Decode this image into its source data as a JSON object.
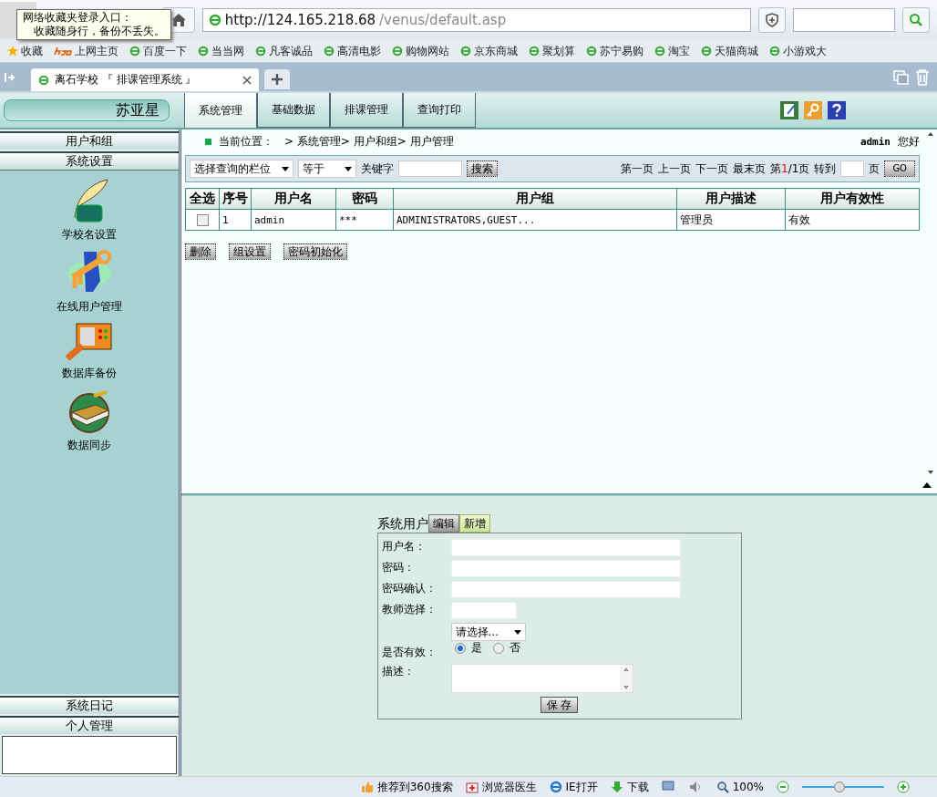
{
  "browser": {
    "address": {
      "host": "http://124.165.218.68",
      "path": "/venus/default.asp"
    },
    "tooltip": {
      "title": "网络收藏夹登录入口：",
      "text": "收藏随身行，备份不丢失。"
    },
    "bookmarks": [
      {
        "label": "收藏",
        "kind": "star"
      },
      {
        "label": "上网主页",
        "kind": "hao"
      },
      {
        "label": "百度一下",
        "kind": "ie"
      },
      {
        "label": "当当网",
        "kind": "ie"
      },
      {
        "label": "凡客诚品",
        "kind": "ie"
      },
      {
        "label": "高清电影",
        "kind": "ie"
      },
      {
        "label": "购物网站",
        "kind": "ie"
      },
      {
        "label": "京东商城",
        "kind": "ie"
      },
      {
        "label": "聚划算",
        "kind": "ie"
      },
      {
        "label": "苏宁易购",
        "kind": "ie"
      },
      {
        "label": "淘宝",
        "kind": "ie"
      },
      {
        "label": "天猫商城",
        "kind": "ie"
      },
      {
        "label": "小游戏大",
        "kind": "ie"
      }
    ],
    "tab": {
      "title": "离石学校 『 排课管理系统 』"
    }
  },
  "app": {
    "brand": "苏亚星",
    "menu": [
      {
        "label": "系统管理",
        "selected": true
      },
      {
        "label": "基础数据",
        "selected": false
      },
      {
        "label": "排课管理",
        "selected": false
      },
      {
        "label": "查询打印",
        "selected": false
      }
    ],
    "sidebar": {
      "sections_top": [
        "用户和组",
        "系统设置"
      ],
      "items": [
        {
          "label": "学校名设置",
          "kind": "quill"
        },
        {
          "label": "在线用户管理",
          "kind": "key"
        },
        {
          "label": "数据库备份",
          "kind": "panel"
        },
        {
          "label": "数据同步",
          "kind": "book"
        }
      ],
      "sections_bottom": [
        "系统日记",
        "个人管理"
      ]
    },
    "breadcrumb": {
      "label": "当前位置：",
      "path": "> 系统管理> 用户和组> 用户管理"
    },
    "greeting": {
      "user": "admin",
      "text": "您好"
    },
    "search": {
      "field_select": "选择查询的栏位",
      "operator": "等于",
      "keyword_label": "关键字",
      "button": "搜索"
    },
    "pager": {
      "first": "第一页",
      "prev": "上一页",
      "next": "下一页",
      "last": "最末页",
      "page_prefix": "第",
      "current": "1",
      "page_suffix": "/1页",
      "goto_label": "转到",
      "page_label": "页",
      "go_button": "GO"
    },
    "table": {
      "columns": [
        "全选",
        "序号",
        "用户名",
        "密码",
        "用户组",
        "用户描述",
        "用户有效性"
      ],
      "rows": [
        {
          "checked": false,
          "cells": [
            "",
            "1",
            "admin",
            "***",
            "ADMINISTRATORS,GUEST...",
            "管理员",
            "有效"
          ]
        }
      ]
    },
    "actions": [
      "删除",
      "组设置",
      "密码初始化"
    ],
    "form": {
      "title": "系统用户",
      "tabs": [
        {
          "label": "编辑",
          "selected": true
        },
        {
          "label": "新增",
          "selected": false
        }
      ],
      "fields": [
        {
          "label": "用户名：",
          "kind": "text"
        },
        {
          "label": "密码：",
          "kind": "text"
        },
        {
          "label": "密码确认：",
          "kind": "text"
        },
        {
          "label": "教师选择：",
          "kind": "teacher",
          "select": "请选择..."
        },
        {
          "label": "是否有效：",
          "kind": "radio",
          "options": [
            {
              "label": "是",
              "selected": true
            },
            {
              "label": "否",
              "selected": false
            }
          ]
        },
        {
          "label": "描述：",
          "kind": "textarea"
        }
      ],
      "save": "保 存"
    }
  },
  "status_bar": {
    "items": [
      {
        "label": "推荐到360搜索",
        "kind": "thumb"
      },
      {
        "label": "浏览器医生",
        "kind": "doctor"
      },
      {
        "label": "IE打开",
        "kind": "ie"
      },
      {
        "label": "下载",
        "kind": "download"
      }
    ],
    "zoom": "100%",
    "zoom_slider": {
      "level": 0.45
    }
  }
}
